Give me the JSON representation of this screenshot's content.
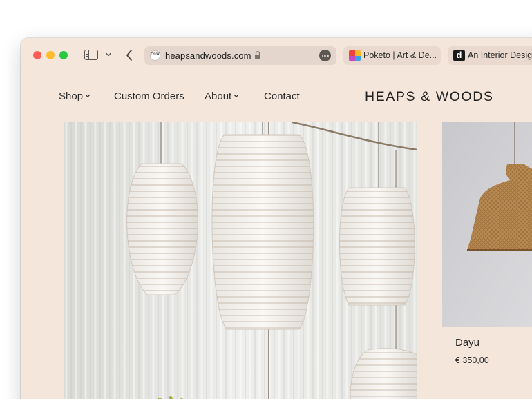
{
  "browser": {
    "address_bar": {
      "url": "heapsandwoods.com",
      "favicon_text": "H&W"
    },
    "tabs": [
      {
        "title": "Poketo | Art & De...",
        "icon": "poketo-logo-icon"
      },
      {
        "title": "An Interior Desig...",
        "icon": "d-logo-icon",
        "icon_text": "d"
      }
    ]
  },
  "site": {
    "logo": "HEAPS & WOODS",
    "nav": [
      {
        "label": "Shop",
        "dropdown": true
      },
      {
        "label": "Custom Orders",
        "dropdown": false
      },
      {
        "label": "About",
        "dropdown": true
      },
      {
        "label": "Contact",
        "dropdown": false
      }
    ]
  },
  "product": {
    "name": "Dayu",
    "price": "€ 350,00"
  },
  "colors": {
    "page_background": "#f5e6dc",
    "address_bar": "#e4d6cc",
    "traffic_red": "#ff5f57",
    "traffic_yellow": "#febc2e",
    "traffic_green": "#28c840"
  }
}
